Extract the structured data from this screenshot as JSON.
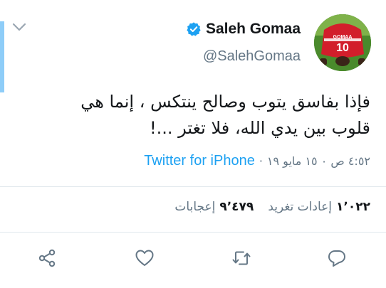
{
  "tweet": {
    "display_name": "Saleh Gomaa",
    "handle": "@SalehGomaa",
    "text_lines": [
      "فإذا بفاسق يتوب وصالح ينتكس ، إنما هي",
      "قلوب بين يدي الله، فلا تغتر ...!"
    ],
    "timestamp": "٤:٥٢ ص ٠ ١٥ مايو ١٩",
    "meta_separator": "·",
    "source": "Twitter for iPhone",
    "avatar_jersey_number": "10",
    "avatar_jersey_name": "GOMAA"
  },
  "stats": {
    "retweets_count": "١٬٠٢٢",
    "retweets_label": "إعادات تغريد",
    "likes_count": "٩٬٤٧٩",
    "likes_label": "إعجابات"
  },
  "icons": {
    "menu": "chevron-down-icon",
    "verified": "verified-badge-icon",
    "share": "share-icon",
    "like": "heart-icon",
    "retweet": "retweet-icon",
    "reply": "reply-icon"
  },
  "colors": {
    "accent_blue": "#1da1f2",
    "secondary_text": "#657786",
    "primary_text": "#14171a",
    "divider": "#e1e8ed",
    "left_bar": "#8ecdf8"
  }
}
